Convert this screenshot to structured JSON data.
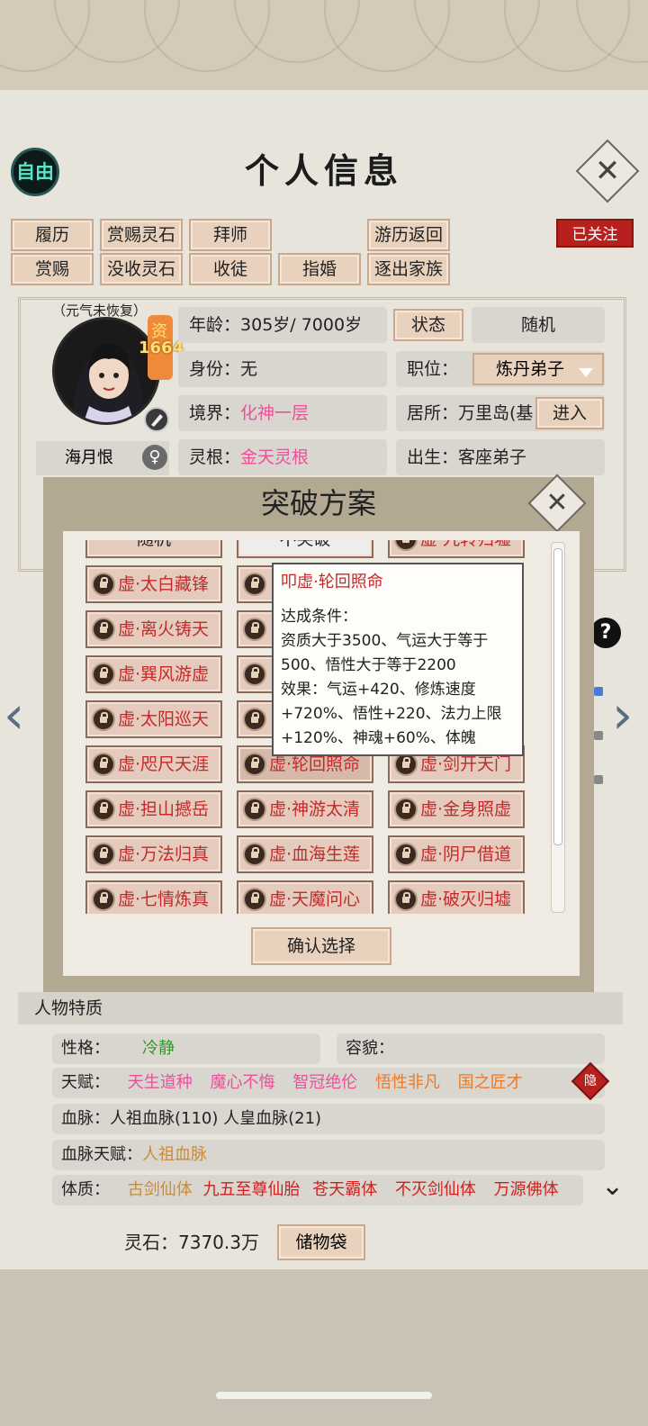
{
  "header": {
    "title": "个人信息",
    "free_badge": "自由",
    "close_glyph": "✕"
  },
  "actions": {
    "row1": [
      "履历",
      "赏赐灵石",
      "拜师",
      "游历返回"
    ],
    "row2": [
      "赏赐",
      "没收灵石",
      "收徒",
      "指婚",
      "逐出家族"
    ],
    "follow": "已关注"
  },
  "profile": {
    "state_tag": "（元气未恢复）",
    "zi_label": "资",
    "zi_value": "1664",
    "root_name": "海月恨",
    "gender_icon": "♀",
    "age_label": "年龄：",
    "age_value": "305岁/ 7000岁",
    "status_button": "状态",
    "random_button": "随机",
    "identity_label": "身份：",
    "identity_value": "无",
    "position_label": "职位：",
    "position_value": "炼丹弟子",
    "realm_label": "境界：",
    "realm_value": "化神一层",
    "residence_label": "居所：",
    "residence_value": "万里岛(基",
    "enter_button": "进入",
    "spirit_root_label": "灵根：",
    "spirit_root_value": "金天灵根",
    "birth_label": "出生：",
    "birth_value": "客座弟子"
  },
  "modal": {
    "title": "突破方案",
    "partial_row": [
      "随机",
      "不突破",
      "虚·九转归墟"
    ],
    "plans": [
      [
        "虚·太白藏锋",
        "",
        ""
      ],
      [
        "虚·离火铸天",
        "",
        ""
      ],
      [
        "虚·巽风游虚",
        "",
        ""
      ],
      [
        "虚·太阳巡天",
        "",
        ""
      ],
      [
        "虚·咫尺天涯",
        "虚·轮回照命",
        "虚·剑开天门"
      ],
      [
        "虚·担山撼岳",
        "虚·神游太清",
        "虚·金身照虚"
      ],
      [
        "虚·万法归真",
        "虚·血海生莲",
        "虚·阴尸借道"
      ],
      [
        "虚·七情炼真",
        "虚·天魔问心",
        "虚·破灭归墟"
      ]
    ],
    "tooltip": {
      "title": "叩虚·轮回照命",
      "condition_label": "达成条件：",
      "condition": "资质大于3500、气运大于等于500、悟性大于等于2200",
      "effect": "效果：气运+420、修炼速度+720%、悟性+220、法力上限+120%、神魂+60%、体魄"
    },
    "confirm": "确认选择"
  },
  "traits": {
    "section_title": "人物特质",
    "personality_label": "性格：",
    "personality_value": "冷静",
    "looks_label": "容貌：",
    "talent_label": "天赋：",
    "talents": [
      {
        "text": "天生道种",
        "color": "#e8529a"
      },
      {
        "text": "魔心不悔",
        "color": "#e8529a"
      },
      {
        "text": "智冠绝伦",
        "color": "#e8529a"
      },
      {
        "text": "悟性非凡",
        "color": "#e87b2a"
      },
      {
        "text": "国之匠才",
        "color": "#e87b2a"
      }
    ],
    "hide_badge": "隐",
    "bloodline_label": "血脉：",
    "bloodline_value": "人祖血脉(110)  人皇血脉(21)",
    "bloodline_talent_label": "血脉天赋：",
    "bloodline_talent_value": "人祖血脉",
    "physique_label": "体质：",
    "physiques": [
      {
        "text": "古剑仙体",
        "color": "#c98b3a"
      },
      {
        "text": "九五至尊仙胎",
        "color": "#d01f1f"
      },
      {
        "text": "苍天霸体",
        "color": "#d01f1f"
      },
      {
        "text": "不灭剑仙体",
        "color": "#d01f1f"
      },
      {
        "text": "万源佛体",
        "color": "#d01f1f"
      }
    ]
  },
  "footer": {
    "stone_label": "灵石：7370.3万",
    "bag_button": "储物袋"
  },
  "side": {
    "help": "?",
    "left_arrow": "‹",
    "right_arrow": "›",
    "more": "⌄"
  }
}
